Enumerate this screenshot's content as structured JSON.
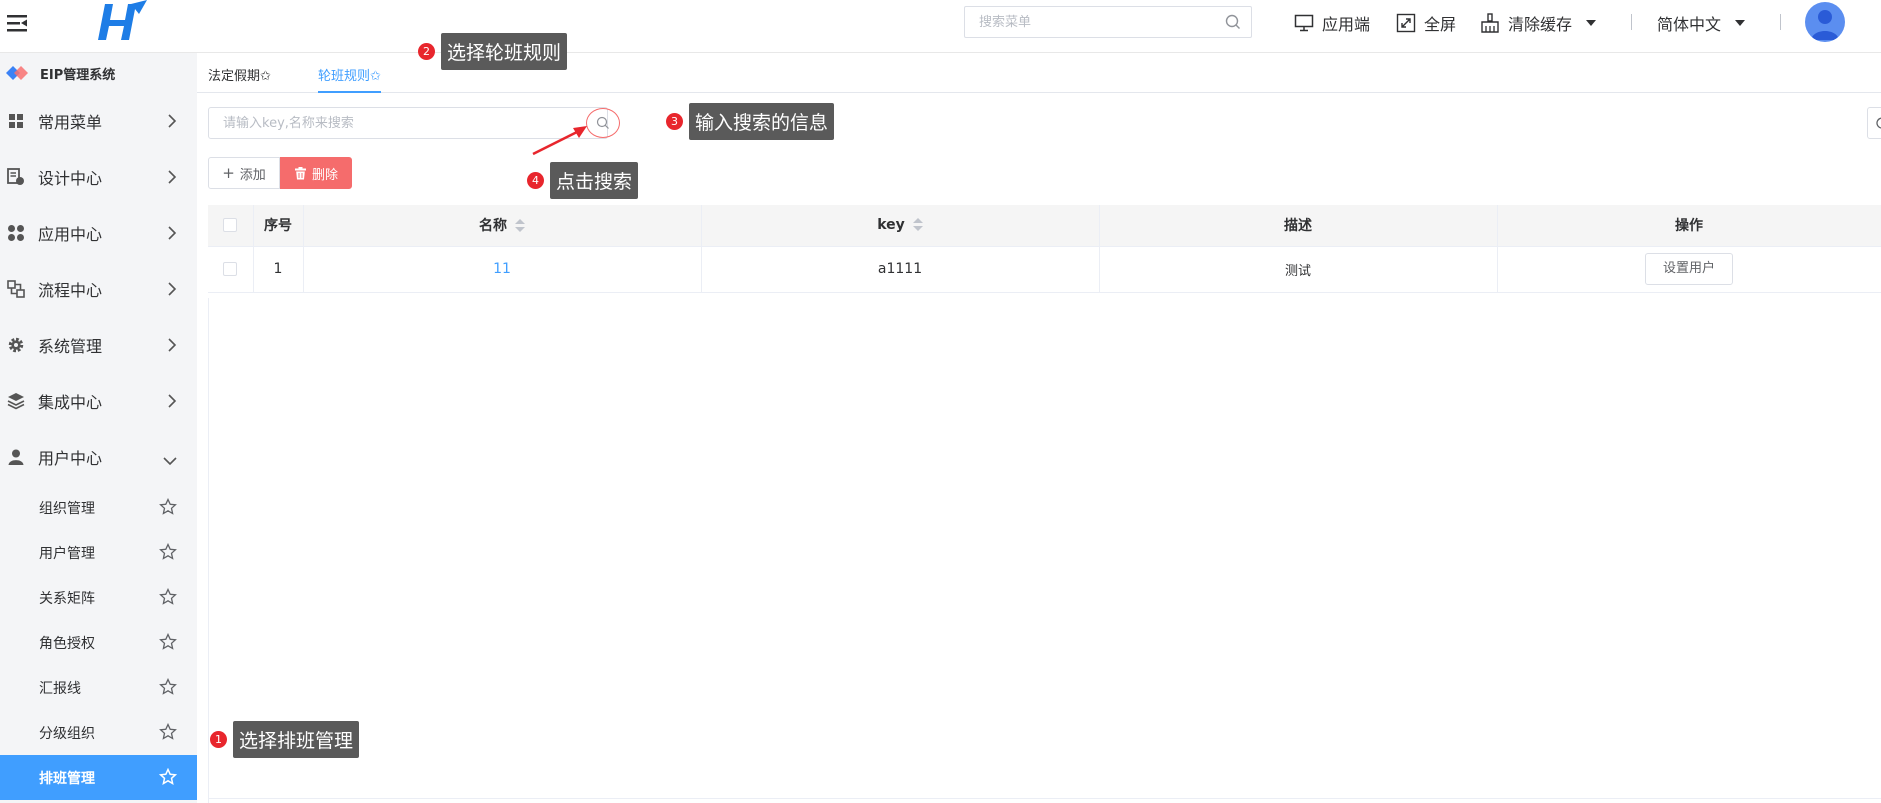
{
  "header": {
    "search_placeholder": "搜索菜单",
    "app_label": "应用端",
    "fullscreen_label": "全屏",
    "clear_cache_label": "清除缓存",
    "language_label": "简体中文"
  },
  "sidebar": {
    "brand": "EIP管理系统",
    "menus": [
      {
        "label": "常用菜单"
      },
      {
        "label": "设计中心"
      },
      {
        "label": "应用中心"
      },
      {
        "label": "流程中心"
      },
      {
        "label": "系统管理"
      },
      {
        "label": "集成中心"
      },
      {
        "label": "用户中心"
      }
    ],
    "submenus": [
      {
        "label": "组织管理"
      },
      {
        "label": "用户管理"
      },
      {
        "label": "关系矩阵"
      },
      {
        "label": "角色授权"
      },
      {
        "label": "汇报线"
      },
      {
        "label": "分级组织"
      },
      {
        "label": "排班管理"
      }
    ]
  },
  "tabs": [
    {
      "label": "法定假期✩"
    },
    {
      "label": "轮班规则✩"
    }
  ],
  "toolbar": {
    "search_placeholder": "请输入key,名称来搜索",
    "add_label": "添加",
    "delete_label": "删除"
  },
  "table": {
    "headers": {
      "index": "序号",
      "name": "名称",
      "key": "key",
      "desc": "描述",
      "ops": "操作"
    },
    "rows": [
      {
        "index": "1",
        "name": "11",
        "key": "a1111",
        "desc": "测试",
        "op_label": "设置用户"
      }
    ]
  },
  "annotations": [
    {
      "num": "1",
      "text": "选择排班管理"
    },
    {
      "num": "2",
      "text": "选择轮班规则"
    },
    {
      "num": "3",
      "text": "输入搜索的信息"
    },
    {
      "num": "4",
      "text": "点击搜索"
    }
  ],
  "colors": {
    "accent": "#409eff",
    "danger": "#f56c6c",
    "annotation_red": "#e8262d",
    "annotation_box": "#5a5a5a"
  }
}
